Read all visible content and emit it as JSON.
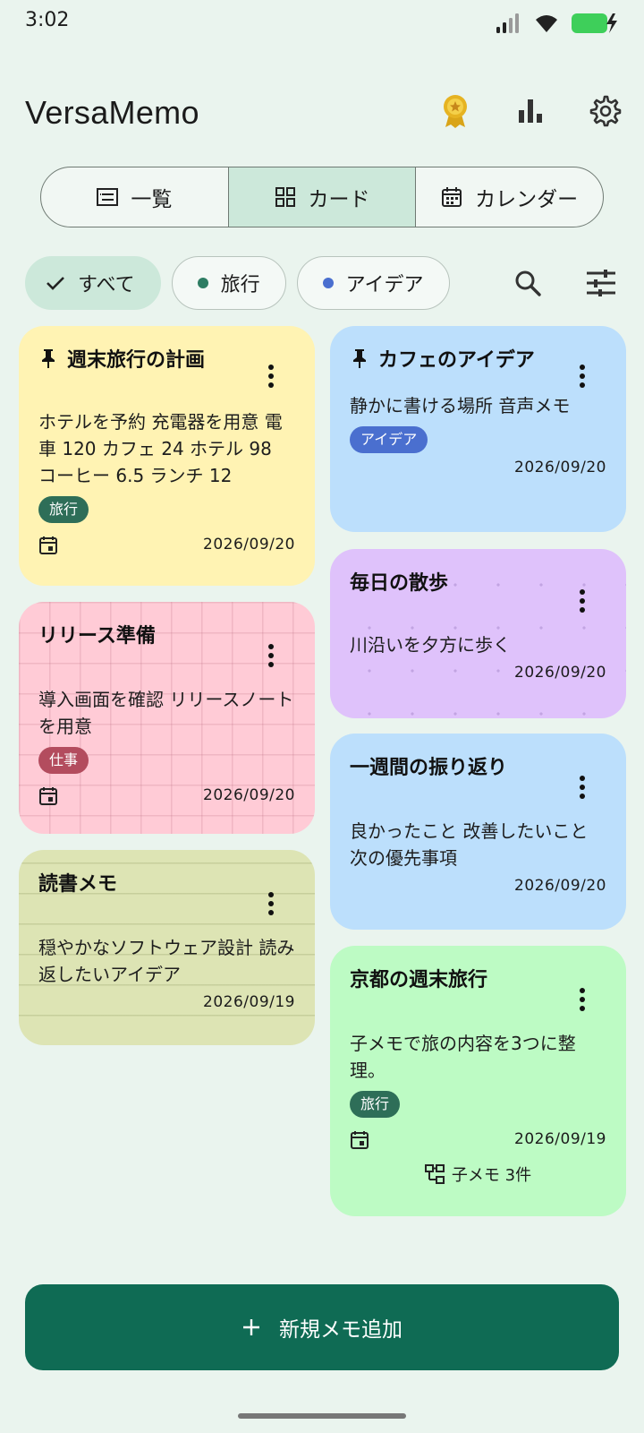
{
  "status": {
    "time": "3:02"
  },
  "app": {
    "title": "VersaMemo"
  },
  "view_tabs": [
    {
      "label": "一覧",
      "icon": "list-icon"
    },
    {
      "label": "カード",
      "icon": "grid-icon"
    },
    {
      "label": "カレンダー",
      "icon": "calendar-icon"
    }
  ],
  "filters": {
    "chips": [
      {
        "label": "すべて",
        "selected": true
      },
      {
        "label": "旅行",
        "dot_color": "#2e7d63"
      },
      {
        "label": "アイデア",
        "dot_color": "#4a6fcf"
      }
    ]
  },
  "cards": {
    "c1": {
      "title": "週末旅行の計画",
      "body": "ホテルを予約 充電器を用意 電車 120 カフェ 24 ホテル 98 コーヒー 6.5 ランチ 12",
      "tag": "旅行",
      "date": "2026/09/20",
      "color": "#fff3b3"
    },
    "c2": {
      "title": "リリース準備",
      "body": "導入画面を確認 リリースノートを用意",
      "tag": "仕事",
      "date": "2026/09/20",
      "color": "#ffcbd6"
    },
    "c3": {
      "title": "読書メモ",
      "body": "穏やかなソフトウェア設計 読み返したいアイデア",
      "date": "2026/09/19",
      "color": "#dde4b4"
    },
    "c4": {
      "title": "カフェのアイデア",
      "body": "静かに書ける場所 音声メモ",
      "tag": "アイデア",
      "date": "2026/09/20",
      "color": "#bcdffc"
    },
    "c5": {
      "title": "毎日の散歩",
      "body": "川沿いを夕方に歩く",
      "date": "2026/09/20",
      "color": "#dfc2fb"
    },
    "c6": {
      "title": "一週間の振り返り",
      "body": "良かったこと 改善したいこと 次の優先事項",
      "date": "2026/09/20",
      "color": "#bcdffc"
    },
    "c7": {
      "title": "京都の週末旅行",
      "body": "子メモで旅の内容を3つに整理。",
      "tag": "旅行",
      "date": "2026/09/19",
      "children": "子メモ 3件",
      "color": "#bdfbc4"
    }
  },
  "tag_colors": {
    "旅行": "#2e6e58",
    "仕事": "#b34c5e",
    "アイデア": "#4a6fcf"
  },
  "fab": {
    "label": "新規メモ追加"
  }
}
